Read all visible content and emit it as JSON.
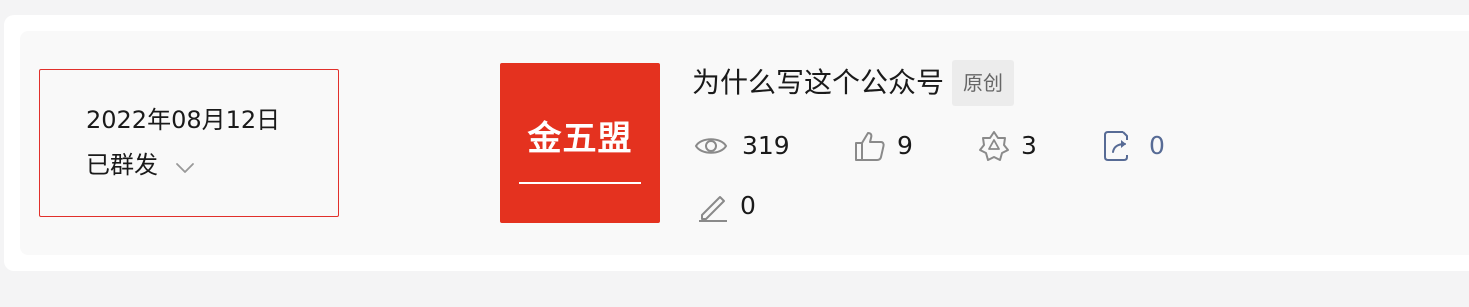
{
  "article": {
    "date": "2022年08月12日",
    "status": "已群发",
    "cover_text": "金五盟",
    "title": "为什么写这个公众号",
    "badge": "原创"
  },
  "stats": {
    "reads": "319",
    "likes": "9",
    "wow": "3",
    "shares": "0",
    "comments": "0"
  },
  "icons": {
    "reads": "eye-icon",
    "likes": "thumbs-up-icon",
    "wow": "wow-icon",
    "shares": "share-icon",
    "comments": "pencil-icon",
    "status": "chevron-down-icon"
  },
  "colors": {
    "accent_red": "#e1302b",
    "cover_red": "#e4321f",
    "link_blue": "#576b95"
  }
}
